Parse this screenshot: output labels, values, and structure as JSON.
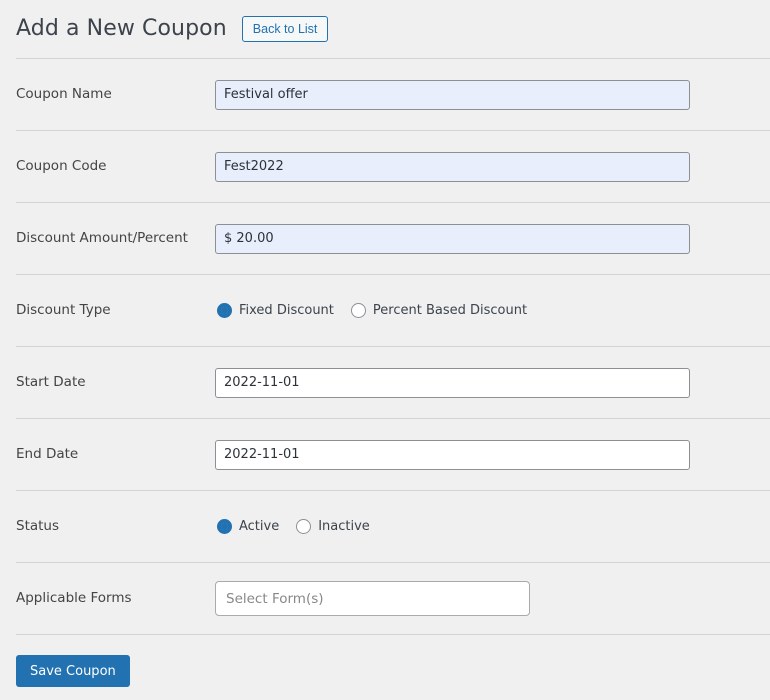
{
  "header": {
    "title": "Add a New Coupon",
    "back_button_label": "Back to List"
  },
  "form": {
    "rows": [
      {
        "label": "Coupon Name",
        "type": "text",
        "value": "Festival offer",
        "autofilled": true
      },
      {
        "label": "Coupon Code",
        "type": "text",
        "value": "Fest2022",
        "autofilled": true
      },
      {
        "label": "Discount Amount/Percent",
        "type": "text",
        "value": "$ 20.00",
        "autofilled": true
      },
      {
        "label": "Discount Type",
        "type": "radio",
        "options": [
          {
            "label": "Fixed Discount",
            "checked": true
          },
          {
            "label": "Percent Based Discount",
            "checked": false
          }
        ]
      },
      {
        "label": "Start Date",
        "type": "text",
        "value": "2022-11-01",
        "autofilled": false
      },
      {
        "label": "End Date",
        "type": "text",
        "value": "2022-11-01",
        "autofilled": false
      },
      {
        "label": "Status",
        "type": "radio",
        "options": [
          {
            "label": "Active",
            "checked": true
          },
          {
            "label": "Inactive",
            "checked": false
          }
        ]
      },
      {
        "label": "Applicable Forms",
        "type": "select",
        "placeholder": "Select Form(s)",
        "value": ""
      }
    ]
  },
  "footer": {
    "save_label": "Save Coupon"
  },
  "colors": {
    "accent": "#2271b1",
    "page_background": "#f0f0f1",
    "divider": "#d3d3d4",
    "autofill_background": "#e8eefc",
    "label_text": "#444444",
    "placeholder_text": "#888888"
  }
}
